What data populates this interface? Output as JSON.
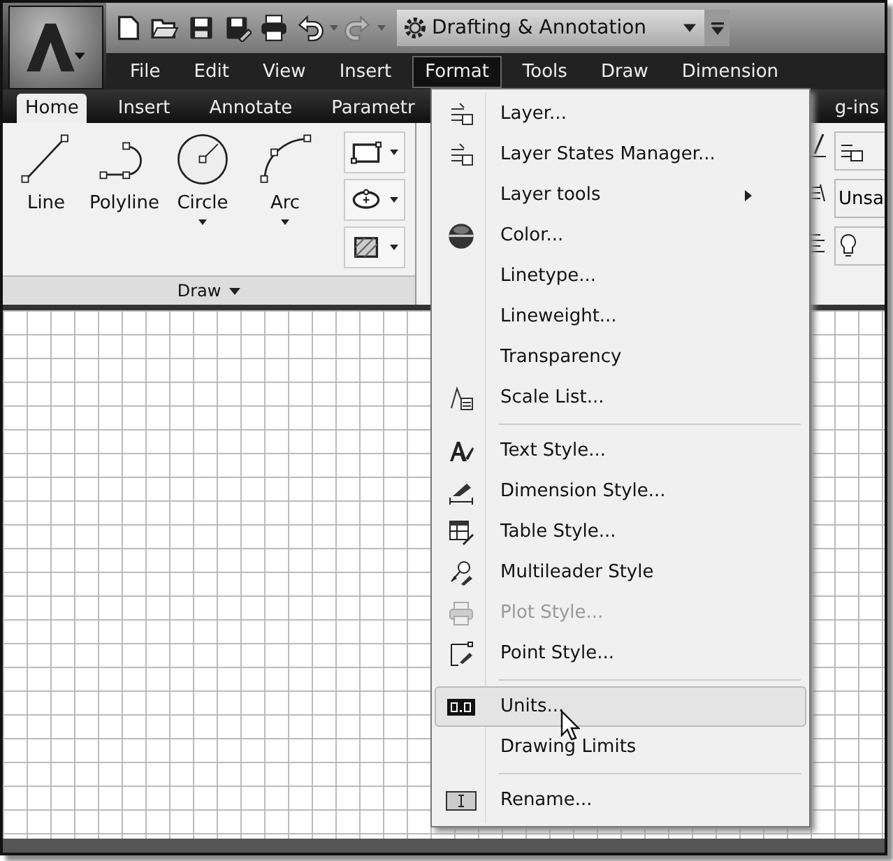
{
  "title_bar": {
    "workspace": "Drafting & Annotation"
  },
  "menu_bar": [
    {
      "label": "File",
      "selected": false
    },
    {
      "label": "Edit",
      "selected": false
    },
    {
      "label": "View",
      "selected": false
    },
    {
      "label": "Insert",
      "selected": false
    },
    {
      "label": "Format",
      "selected": true
    },
    {
      "label": "Tools",
      "selected": false
    },
    {
      "label": "Draw",
      "selected": false
    },
    {
      "label": "Dimension",
      "selected": false
    }
  ],
  "ribbon_tabs": [
    {
      "label": "Home",
      "selected": true
    },
    {
      "label": "Insert",
      "selected": false
    },
    {
      "label": "Annotate",
      "selected": false
    },
    {
      "label": "Parametr",
      "selected": false
    }
  ],
  "ribbon_tab_right": "g-ins",
  "draw_panel": {
    "title": "Draw",
    "tools": [
      {
        "label": "Line",
        "dropdown": false
      },
      {
        "label": "Polyline",
        "dropdown": false
      },
      {
        "label": "Circle",
        "dropdown": true
      },
      {
        "label": "Arc",
        "dropdown": true
      }
    ]
  },
  "layers_panel": {
    "text": "Unsa"
  },
  "format_menu": [
    {
      "kind": "item",
      "label": "Layer...",
      "disabled": false,
      "highlighted": false,
      "submenu": false
    },
    {
      "kind": "item",
      "label": "Layer States Manager...",
      "disabled": false,
      "highlighted": false,
      "submenu": false
    },
    {
      "kind": "item",
      "label": "Layer tools",
      "disabled": false,
      "highlighted": false,
      "submenu": true
    },
    {
      "kind": "item",
      "label": "Color...",
      "disabled": false,
      "highlighted": false,
      "submenu": false
    },
    {
      "kind": "item",
      "label": "Linetype...",
      "disabled": false,
      "highlighted": false,
      "submenu": false
    },
    {
      "kind": "item",
      "label": "Lineweight...",
      "disabled": false,
      "highlighted": false,
      "submenu": false
    },
    {
      "kind": "item",
      "label": "Transparency",
      "disabled": false,
      "highlighted": false,
      "submenu": false
    },
    {
      "kind": "item",
      "label": "Scale List...",
      "disabled": false,
      "highlighted": false,
      "submenu": false
    },
    {
      "kind": "separator"
    },
    {
      "kind": "item",
      "label": "Text Style...",
      "disabled": false,
      "highlighted": false,
      "submenu": false
    },
    {
      "kind": "item",
      "label": "Dimension Style...",
      "disabled": false,
      "highlighted": false,
      "submenu": false
    },
    {
      "kind": "item",
      "label": "Table Style...",
      "disabled": false,
      "highlighted": false,
      "submenu": false
    },
    {
      "kind": "item",
      "label": "Multileader Style",
      "disabled": false,
      "highlighted": false,
      "submenu": false
    },
    {
      "kind": "item",
      "label": "Plot Style...",
      "disabled": true,
      "highlighted": false,
      "submenu": false
    },
    {
      "kind": "item",
      "label": "Point Style...",
      "disabled": false,
      "highlighted": false,
      "submenu": false
    },
    {
      "kind": "separator"
    },
    {
      "kind": "item",
      "label": "Units...",
      "disabled": false,
      "highlighted": true,
      "submenu": false
    },
    {
      "kind": "item",
      "label": "Drawing Limits",
      "disabled": false,
      "highlighted": false,
      "submenu": false
    },
    {
      "kind": "separator"
    },
    {
      "kind": "item",
      "label": "Rename...",
      "disabled": false,
      "highlighted": false,
      "submenu": false
    }
  ]
}
